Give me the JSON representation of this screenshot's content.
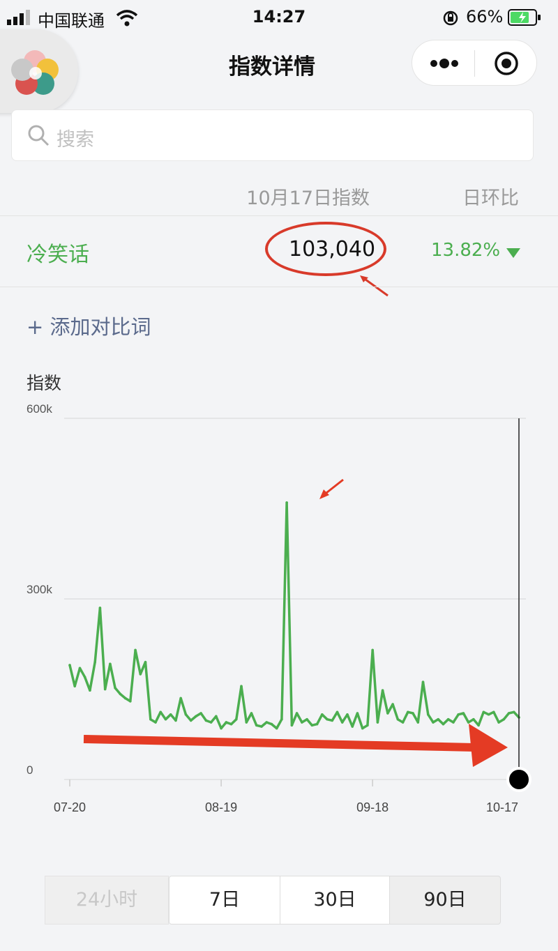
{
  "status_bar": {
    "carrier": "中国联通",
    "time": "14:27",
    "battery": "66%"
  },
  "nav": {
    "title": "指数详情"
  },
  "search": {
    "placeholder": "搜索"
  },
  "table": {
    "col_index": "10月17日指数",
    "col_change": "日环比",
    "row": {
      "keyword": "冷笑话",
      "value": "103,040",
      "change": "13.82%",
      "direction": "down"
    }
  },
  "add_compare": "+ 添加对比词",
  "colors": {
    "accent_green": "#4bae4f",
    "annotation_red": "#d83a2a",
    "link_blue": "#5b6a8c"
  },
  "icons": [
    "signal-icon",
    "wifi-icon",
    "rotation-lock-icon",
    "battery-icon",
    "search-icon",
    "more-icon",
    "close-target-icon",
    "app-logo-icon"
  ],
  "chart_data": {
    "type": "line",
    "ylabel": "指数",
    "yticks": [
      "600k",
      "300k",
      "0"
    ],
    "ylim": [
      0,
      600000
    ],
    "xticks": [
      "07-20",
      "08-19",
      "09-18",
      "10-17"
    ],
    "x": [
      "07-20",
      "07-21",
      "07-22",
      "07-23",
      "07-24",
      "07-25",
      "07-26",
      "07-27",
      "07-28",
      "07-29",
      "07-30",
      "07-31",
      "08-01",
      "08-02",
      "08-03",
      "08-04",
      "08-05",
      "08-06",
      "08-07",
      "08-08",
      "08-09",
      "08-10",
      "08-11",
      "08-12",
      "08-13",
      "08-14",
      "08-15",
      "08-16",
      "08-17",
      "08-18",
      "08-19",
      "08-20",
      "08-21",
      "08-22",
      "08-23",
      "08-24",
      "08-25",
      "08-26",
      "08-27",
      "08-28",
      "08-29",
      "08-30",
      "08-31",
      "09-01",
      "09-02",
      "09-03",
      "09-04",
      "09-05",
      "09-06",
      "09-07",
      "09-08",
      "09-09",
      "09-10",
      "09-11",
      "09-12",
      "09-13",
      "09-14",
      "09-15",
      "09-16",
      "09-17",
      "09-18",
      "09-19",
      "09-20",
      "09-21",
      "09-22",
      "09-23",
      "09-24",
      "09-25",
      "09-26",
      "09-27",
      "09-28",
      "09-29",
      "09-30",
      "10-01",
      "10-02",
      "10-03",
      "10-04",
      "10-05",
      "10-06",
      "10-07",
      "10-08",
      "10-09",
      "10-10",
      "10-11",
      "10-12",
      "10-13",
      "10-14",
      "10-15",
      "10-16",
      "10-17"
    ],
    "series": [
      {
        "values": [
          190000,
          155000,
          185000,
          170000,
          148000,
          195000,
          285000,
          150000,
          192000,
          152000,
          142000,
          135000,
          130000,
          215000,
          175000,
          195000,
          100000,
          95000,
          112000,
          100000,
          108000,
          98000,
          135000,
          108000,
          98000,
          105000,
          110000,
          98000,
          95000,
          105000,
          85000,
          95000,
          92000,
          100000,
          155000,
          95000,
          110000,
          90000,
          88000,
          95000,
          92000,
          85000,
          100000,
          460000,
          90000,
          110000,
          95000,
          100000,
          90000,
          92000,
          108000,
          100000,
          98000,
          112000,
          95000,
          108000,
          88000,
          110000,
          85000,
          90000,
          215000,
          95000,
          148000,
          110000,
          125000,
          100000,
          95000,
          112000,
          110000,
          95000,
          162000,
          108000,
          95000,
          100000,
          92000,
          100000,
          95000,
          108000,
          110000,
          95000,
          100000,
          90000,
          112000,
          108000,
          112000,
          95000,
          100000,
          110000,
          112000,
          103040
        ]
      }
    ],
    "grid": true,
    "highlight_point": "10-17"
  },
  "time_ranges": {
    "options": [
      "24小时",
      "7日",
      "30日",
      "90日"
    ],
    "selected": "90日"
  }
}
